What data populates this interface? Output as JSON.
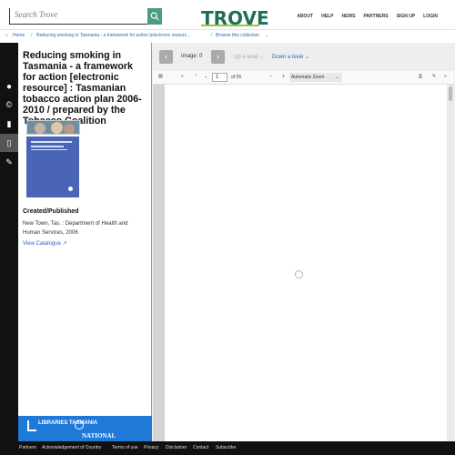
{
  "search": {
    "placeholder": "Search Trove"
  },
  "header": {
    "logo": "TROVE",
    "nav": [
      "ABOUT",
      "HELP",
      "NEWS",
      "PARTNERS",
      "SIGN UP",
      "LOGIN"
    ]
  },
  "breadcrumbs": {
    "home": "Home",
    "current": "Reducing smoking in Tasmania - a framework for action [electronic resourc...",
    "browse": "Browse this collection"
  },
  "sidebar": {
    "icons": [
      "info-icon",
      "copyright-icon",
      "bookmark-icon",
      "document-icon",
      "tag-icon"
    ]
  },
  "record": {
    "title": "Reducing smoking in Tasmania - a framework for action [electronic resource] : Tasmanian tobacco action plan 2006-2010 / prepared by the Tobacco Coalition",
    "created_heading": "Created/Published",
    "created_text": "New Town, Tas. : Department of Health and Human Services, 2006",
    "catalogue_link": "View Catalogue"
  },
  "libraries": {
    "brand": "LIBRARIES TASMANIA",
    "sub": "NATIONAL"
  },
  "viewer": {
    "image_label": "Image: 0",
    "up_level": "Up a level",
    "down_level": "Down a level"
  },
  "pdf": {
    "page_number": "1",
    "page_total": "of 26",
    "zoom": "Automatic Zoom"
  },
  "footer": {
    "links": [
      "Partners",
      "Acknowledgement of Country",
      "Terms of use",
      "Privacy",
      "Disclaimer",
      "Contact",
      "Subscribe"
    ]
  }
}
